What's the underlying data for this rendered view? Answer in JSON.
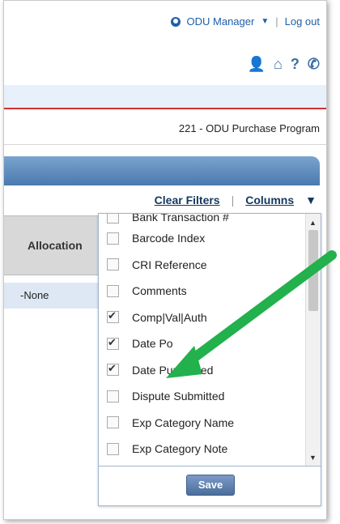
{
  "header": {
    "user_label": "ODU Manager",
    "logout_label": "Log out",
    "separator": "|",
    "program_label": "221 - ODU Purchase Program"
  },
  "toolbar": {
    "icons": [
      "manager-icon",
      "home-icon",
      "help-icon",
      "phone-icon"
    ],
    "clear_filters_label": "Clear Filters",
    "columns_label": "Columns"
  },
  "grid": {
    "header_label": "Allocation",
    "row_value": "-None"
  },
  "columns_panel": {
    "items": [
      {
        "label": "Bank Transaction #",
        "checked": false
      },
      {
        "label": "Barcode Index",
        "checked": false
      },
      {
        "label": "CRI Reference",
        "checked": false
      },
      {
        "label": "Comments",
        "checked": false
      },
      {
        "label": "Comp|Val|Auth",
        "checked": true
      },
      {
        "label": "Date Po",
        "checked": true
      },
      {
        "label": "Date Purchased",
        "checked": true
      },
      {
        "label": "Dispute Submitted",
        "checked": false
      },
      {
        "label": "Exp Category Name",
        "checked": false
      },
      {
        "label": "Exp Category Note",
        "checked": false
      }
    ],
    "save_label": "Save"
  },
  "colors": {
    "link": "#1f5fa8",
    "blue_bar": "#4a79ad",
    "accent_red": "#d32f2f",
    "arrow_green": "#22b14c"
  }
}
